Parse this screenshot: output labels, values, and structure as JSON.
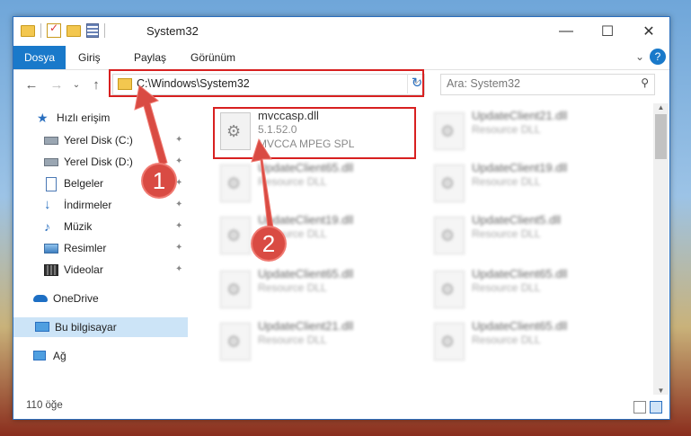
{
  "window": {
    "title": "System32",
    "minimize": "—",
    "maximize": "☐",
    "close": "✕"
  },
  "ribbon": {
    "tabs": [
      "Dosya",
      "Giriş",
      "Paylaş",
      "Görünüm"
    ],
    "expand": "⌄",
    "help": "?"
  },
  "nav": {
    "back": "←",
    "forward": "→",
    "recent": "⌄",
    "up": "↑",
    "address": "C:\\Windows\\System32",
    "address_dropdown": "⌵",
    "refresh": "↻",
    "search_placeholder": "Ara: System32",
    "search_icon": "⚲"
  },
  "sidebar": {
    "quick_access": "Hızlı erişim",
    "items": [
      {
        "label": "Yerel Disk (C:)",
        "icon": "drive-icon",
        "pinned": true
      },
      {
        "label": "Yerel Disk (D:)",
        "icon": "drive-icon",
        "pinned": true
      },
      {
        "label": "Belgeler",
        "icon": "documents-icon",
        "pinned": true
      },
      {
        "label": "İndirmeler",
        "icon": "downloads-icon",
        "pinned": true
      },
      {
        "label": "Müzik",
        "icon": "music-icon",
        "pinned": true
      },
      {
        "label": "Resimler",
        "icon": "pictures-icon",
        "pinned": true
      },
      {
        "label": "Videolar",
        "icon": "videos-icon",
        "pinned": true
      }
    ],
    "onedrive": "OneDrive",
    "this_pc": "Bu bilgisayar",
    "network": "Ağ",
    "pin_glyph": "📌"
  },
  "files": {
    "main": {
      "name": "mvccasp.dll",
      "version": "5.1.52.0",
      "description": "MVCCA MPEG SPL"
    },
    "col1": [
      {
        "name": "UpdateClient65.dll",
        "type": "Resource DLL"
      },
      {
        "name": "UpdateClient19.dll",
        "type": "Resource DLL"
      },
      {
        "name": "UpdateClient65.dll",
        "type": "Resource DLL"
      },
      {
        "name": "UpdateClient21.dll",
        "type": "Resource DLL"
      }
    ],
    "col2": [
      {
        "name": "UpdateClient21.dll",
        "type": "Resource DLL"
      },
      {
        "name": "UpdateClient19.dll",
        "type": "Resource DLL"
      },
      {
        "name": "UpdateClient5.dll",
        "type": "Resource DLL"
      },
      {
        "name": "UpdateClient65.dll",
        "type": "Resource DLL"
      },
      {
        "name": "UpdateClient65.dll",
        "type": "Resource DLL"
      }
    ]
  },
  "status": {
    "count": "110 öğe"
  },
  "callouts": {
    "one": "1",
    "two": "2"
  },
  "colors": {
    "accent": "#1979ca",
    "highlight": "#d82020",
    "callout": "#d94b43"
  }
}
